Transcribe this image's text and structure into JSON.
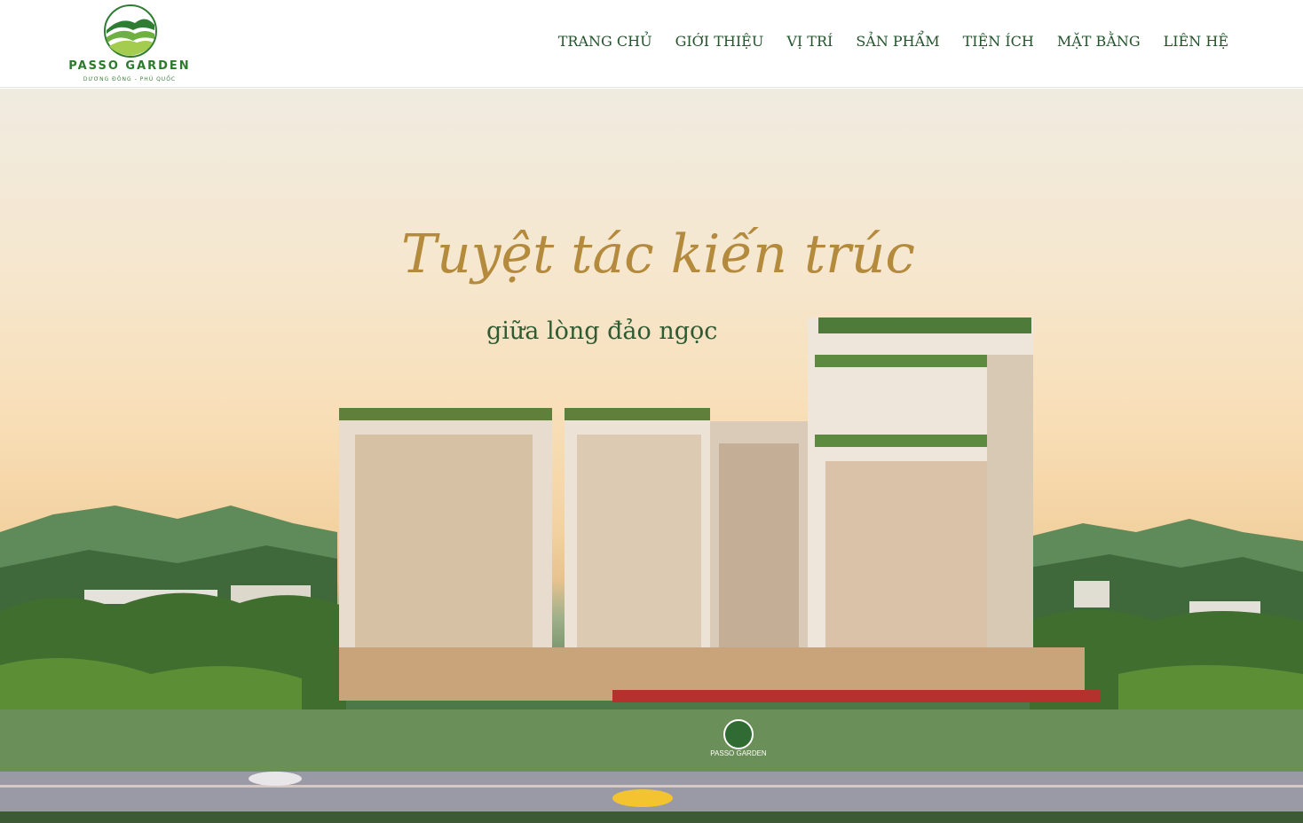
{
  "site": {
    "logo_name": "PASSO GARDEN",
    "logo_sub": "DƯƠNG ĐÔNG - PHÚ QUỐC",
    "logo_icon": "leaf-hills-logo-icon",
    "brand_color": "#2c7a2c",
    "nav_color": "#22532b"
  },
  "nav": {
    "items": [
      {
        "label": "TRANG CHỦ"
      },
      {
        "label": "GIỚI THIỆU"
      },
      {
        "label": "VỊ TRÍ"
      },
      {
        "label": "SẢN PHẨM"
      },
      {
        "label": "TIỆN ÍCH"
      },
      {
        "label": "MẶT BẰNG"
      },
      {
        "label": "LIÊN HỆ"
      }
    ]
  },
  "hero": {
    "headline": "Tuyệt tác kiến trúc",
    "subheadline": "giữa lòng đảo ngọc",
    "sign_text": "PASSO GARDEN",
    "headline_color": "#b48a3d",
    "subheadline_color": "#2f5b33"
  }
}
